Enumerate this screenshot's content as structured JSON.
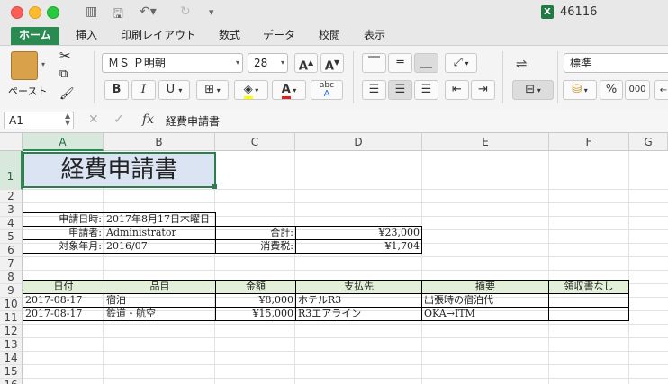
{
  "window": {
    "title": "46116"
  },
  "tabs": [
    "ホーム",
    "挿入",
    "印刷レイアウト",
    "数式",
    "データ",
    "校閲",
    "表示"
  ],
  "ribbon": {
    "paste_label": "ペースト",
    "font_name": "ＭＳ Ｐ明朝",
    "font_size": "28",
    "number_format": "標準",
    "percent": "%",
    "thousands": "000",
    "bold": "B",
    "italic": "I",
    "underline": "U",
    "grow_font": "A",
    "shrink_font": "A",
    "phonetic": "abc"
  },
  "formula_bar": {
    "name_box": "A1",
    "fx": "fx",
    "content": "経費申請書"
  },
  "columns": [
    "A",
    "B",
    "C",
    "D",
    "E",
    "F",
    "G"
  ],
  "rows": [
    "1",
    "2",
    "3",
    "4",
    "5",
    "6",
    "7",
    "8",
    "9",
    "10",
    "11",
    "12",
    "13",
    "14",
    "15",
    "16"
  ],
  "sheet": {
    "title": "経費申請書",
    "info": [
      {
        "label": "申請日時:",
        "value": "2017年8月17日木曜日"
      },
      {
        "label": "申請者:",
        "value": "Administrator",
        "label2": "合計:",
        "value2": "¥23,000"
      },
      {
        "label": "対象年月:",
        "value": "2016/07",
        "label2": "消費税:",
        "value2": "¥1,704"
      }
    ],
    "table_headers": [
      "日付",
      "品目",
      "金額",
      "支払先",
      "摘要",
      "領収書なし"
    ],
    "table_rows": [
      [
        "2017-08-17",
        "宿泊",
        "¥8,000",
        "ホテルR3",
        "出張時の宿泊代",
        ""
      ],
      [
        "2017-08-17",
        "鉄道・航空",
        "¥15,000",
        "R3エアライン",
        "OKA→ITM",
        ""
      ]
    ]
  }
}
